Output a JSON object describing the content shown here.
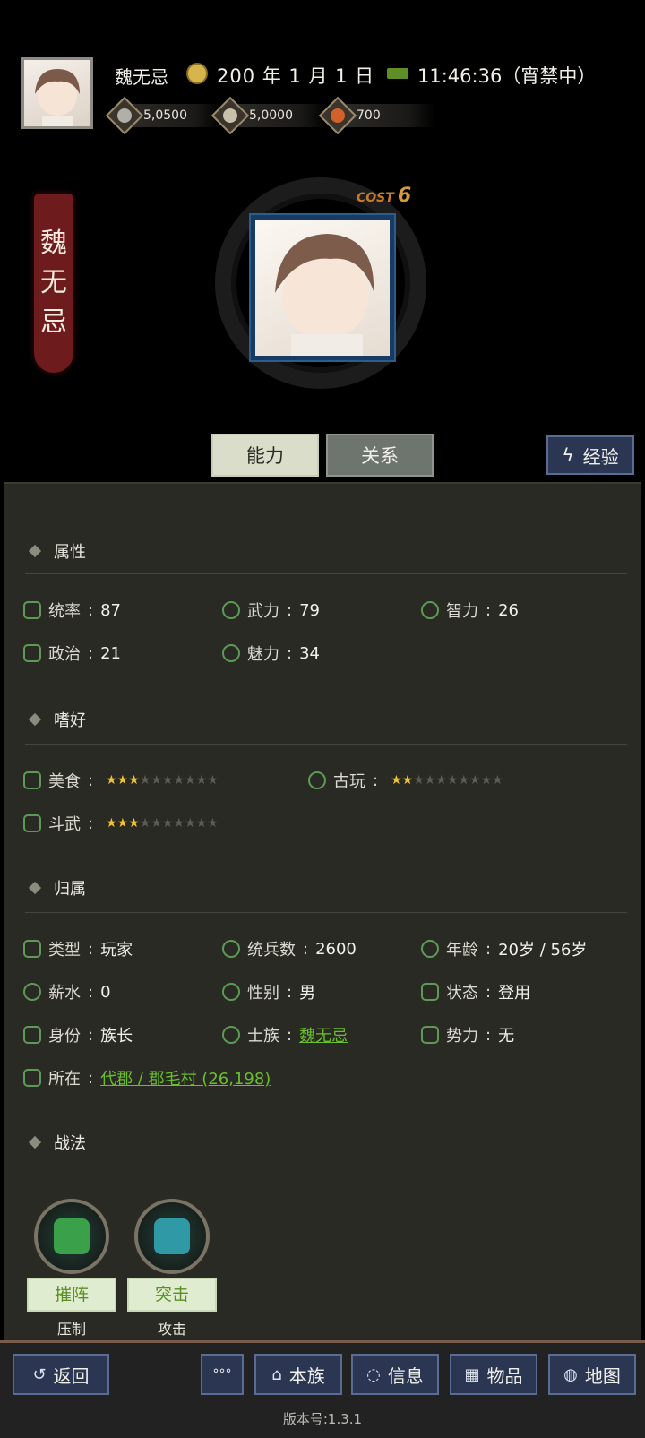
{
  "header": {
    "player_name": "魏无忌",
    "date": "200 年 1 月 1 日",
    "time": "11:46:36（宵禁中）",
    "resources": [
      {
        "icon": "silver-coin-icon",
        "value": "5,0500",
        "color": "#b0b0a8"
      },
      {
        "icon": "grain-icon",
        "value": "5,0000",
        "color": "#c8c0a8"
      },
      {
        "icon": "gem-icon",
        "value": "700",
        "color": "#d2622a"
      }
    ]
  },
  "hero": {
    "banner_name": [
      "魏",
      "无",
      "忌"
    ],
    "cost_label": "COST",
    "cost_value": "6"
  },
  "tabs": {
    "ability": "能力",
    "relation": "关系",
    "experience": "经验"
  },
  "attributes": {
    "title": "属性",
    "items": [
      {
        "label": "统率",
        "value": "87"
      },
      {
        "label": "武力",
        "value": "79"
      },
      {
        "label": "智力",
        "value": "26"
      },
      {
        "label": "政治",
        "value": "21"
      },
      {
        "label": "魅力",
        "value": "34"
      }
    ]
  },
  "hobbies": {
    "title": "嗜好",
    "items": [
      {
        "label": "美食",
        "stars": 2.5,
        "max": 10
      },
      {
        "label": "古玩",
        "stars": 2,
        "max": 10
      },
      {
        "label": "斗武",
        "stars": 3,
        "max": 10
      }
    ]
  },
  "affiliation": {
    "title": "归属",
    "type_label": "类型",
    "type_value": "玩家",
    "troops_label": "统兵数",
    "troops_value": "2600",
    "age_label": "年龄",
    "age_value": "20岁 / 56岁",
    "salary_label": "薪水",
    "salary_value": "0",
    "gender_label": "性别",
    "gender_value": "男",
    "status_label": "状态",
    "status_value": "登用",
    "identity_label": "身份",
    "identity_value": "族长",
    "clan_label": "士族",
    "clan_value": "魏无忌",
    "faction_label": "势力",
    "faction_value": "无",
    "location_label": "所在",
    "location_value": "代郡 / 郡毛村 (26,198)"
  },
  "tactics": {
    "title": "战法",
    "items": [
      {
        "name": "摧阵",
        "type": "压制",
        "color": "#3aa04a"
      },
      {
        "name": "突击",
        "type": "攻击",
        "color": "#2f9aa6"
      }
    ]
  },
  "bottom_nav": {
    "back": "返回",
    "more": "°°°",
    "clan": "本族",
    "info": "信息",
    "items": "物品",
    "map": "地图",
    "version": "版本号:1.3.1"
  }
}
